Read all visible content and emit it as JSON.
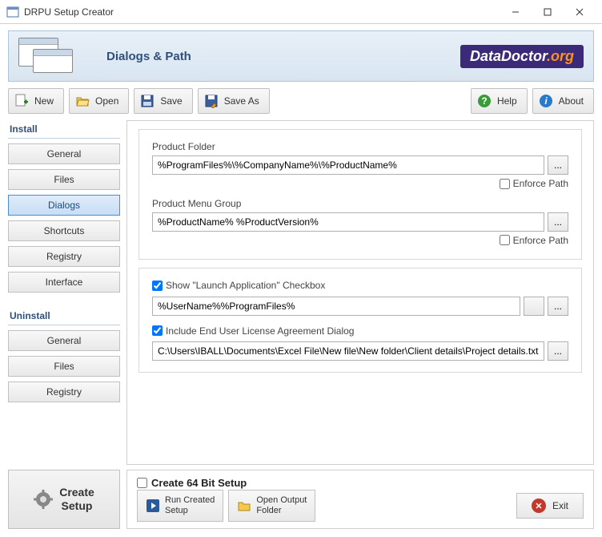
{
  "window": {
    "title": "DRPU Setup Creator"
  },
  "banner": {
    "title": "Dialogs & Path",
    "logo_text": "DataDoctor",
    "logo_suffix": ".org"
  },
  "toolbar": {
    "new": "New",
    "open": "Open",
    "save": "Save",
    "saveas": "Save As",
    "help": "Help",
    "about": "About"
  },
  "sidebar": {
    "install_label": "Install",
    "install": [
      "General",
      "Files",
      "Dialogs",
      "Shortcuts",
      "Registry",
      "Interface"
    ],
    "uninstall_label": "Uninstall",
    "uninstall": [
      "General",
      "Files",
      "Registry"
    ]
  },
  "form": {
    "product_folder_label": "Product Folder",
    "product_folder": "%ProgramFiles%\\%CompanyName%\\%ProductName%",
    "enforce_path": "Enforce Path",
    "product_menu_label": "Product Menu Group",
    "product_menu": "%ProductName% %ProductVersion%",
    "show_launch": "Show \"Launch Application\" Checkbox",
    "launch_path": "%UserName%%ProgramFiles%",
    "include_eula": "Include End User License Agreement Dialog",
    "eula_path": "C:\\Users\\IBALL\\Documents\\Excel File\\New file\\New folder\\Client details\\Project details.txt",
    "browse": "..."
  },
  "bottom": {
    "create_setup": "Create Setup",
    "create_64": "Create 64 Bit Setup",
    "run_created": "Run Created Setup",
    "open_output": "Open Output Folder",
    "exit": "Exit"
  }
}
